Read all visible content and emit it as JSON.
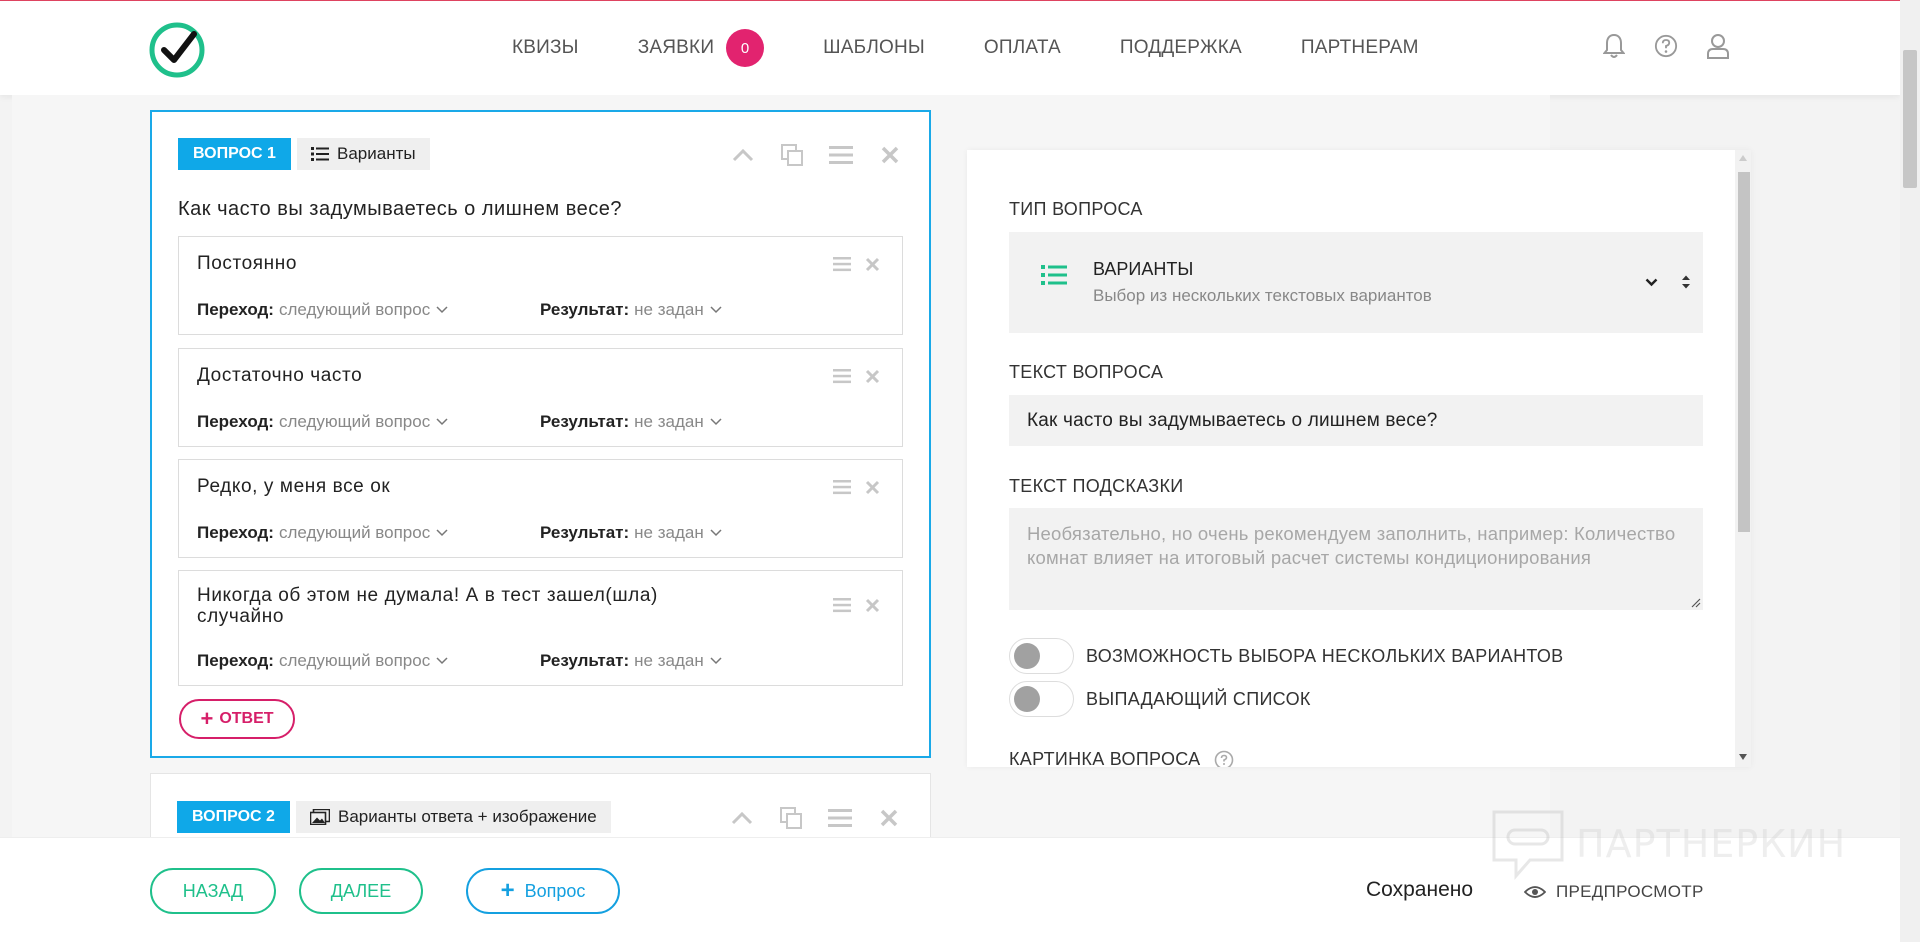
{
  "header": {
    "nav": [
      {
        "label": "КВИЗЫ"
      },
      {
        "label": "ЗАЯВКИ",
        "badge": "0"
      },
      {
        "label": "ШАБЛОНЫ"
      },
      {
        "label": "ОПЛАТА"
      },
      {
        "label": "ПОДДЕРЖКА"
      },
      {
        "label": "ПАРТНЕРАМ"
      }
    ],
    "icons": [
      "bell-icon",
      "help-icon",
      "user-icon"
    ]
  },
  "question1": {
    "tag": "ВОПРОС 1",
    "type": "Варианты",
    "title": "Как часто вы задумываетесь о лишнем весе?",
    "answers": [
      {
        "text": "Постоянно",
        "transition_label": "Переход:",
        "transition_value": "следующий вопрос",
        "result_label": "Результат:",
        "result_value": "не задан"
      },
      {
        "text": "Достаточно часто",
        "transition_label": "Переход:",
        "transition_value": "следующий вопрос",
        "result_label": "Результат:",
        "result_value": "не задан"
      },
      {
        "text": "Редко, у меня все ок",
        "transition_label": "Переход:",
        "transition_value": "следующий вопрос",
        "result_label": "Результат:",
        "result_value": "не задан"
      },
      {
        "text": "Никогда об этом не думала! А в тест зашел(шла) случайно",
        "transition_label": "Переход:",
        "transition_value": "следующий вопрос",
        "result_label": "Результат:",
        "result_value": "не задан"
      }
    ],
    "add_answer": "ОТВЕТ"
  },
  "question2": {
    "tag": "ВОПРОС 2",
    "type": "Варианты ответа + изображение"
  },
  "panel": {
    "type_label": "ТИП ВОПРОСА",
    "type_title": "ВАРИАНТЫ",
    "type_desc": "Выбор из нескольких текстовых вариантов",
    "text_label": "ТЕКСТ ВОПРОСА",
    "text_value": "Как часто вы задумываетесь о лишнем весе?",
    "hint_label": "ТЕКСТ ПОДСКАЗКИ",
    "hint_placeholder": "Необязательно, но очень рекомендуем заполнить, например: Количество комнат влияет на итоговый расчет системы кондиционирования",
    "multi_label": "ВОЗМОЖНОСТЬ ВЫБОРА НЕСКОЛЬКИХ ВАРИАНТОВ",
    "multi_on": false,
    "dropdown_label": "ВЫПАДАЮЩИЙ СПИСОК",
    "dropdown_on": false,
    "image_label": "КАРТИНКА ВОПРОСА"
  },
  "bottom": {
    "back": "НАЗАД",
    "next": "ДАЛЕЕ",
    "add_question": "Вопрос",
    "saved": "Сохранено",
    "preview": "ПРЕДПРОСМОТР"
  },
  "watermark": "ПАРТНЕРКИН",
  "colors": {
    "accent_blue": "#1aa9e8",
    "accent_green": "#1fc08b",
    "accent_pink": "#d61f69"
  }
}
